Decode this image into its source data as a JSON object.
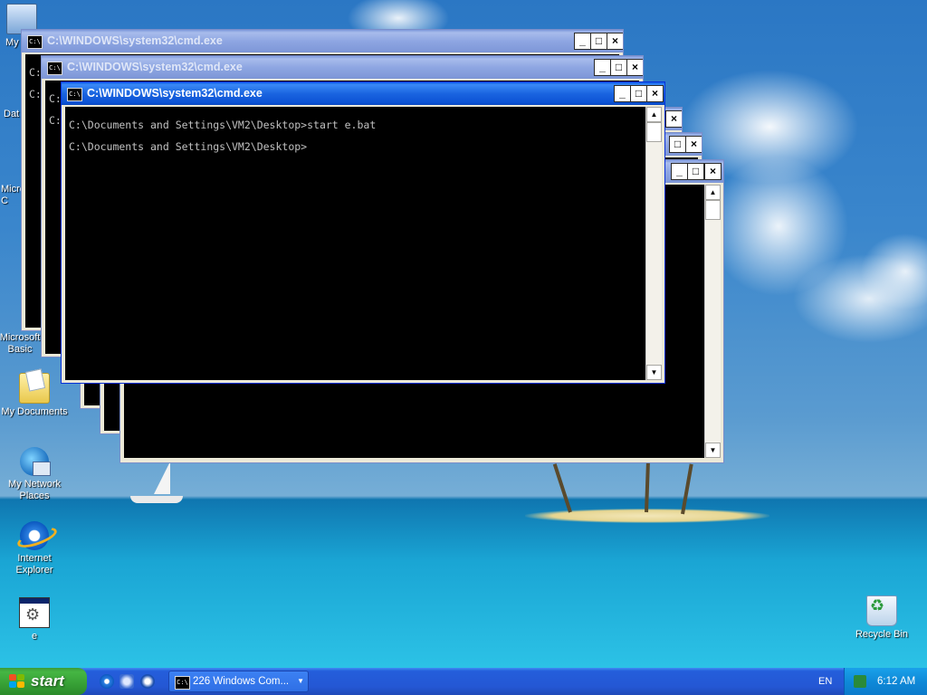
{
  "desktop": {
    "icons": [
      {
        "label": "My",
        "icon": "my-computer-icon"
      },
      {
        "label": "Dat",
        "icon": "data-icon"
      },
      {
        "label": "Micros",
        "icon": "microsoft-icon"
      },
      {
        "label": "C",
        "icon": ""
      },
      {
        "label": "Microsoft Basic",
        "icon": "microsoft-basic-icon"
      },
      {
        "label": "My Documents",
        "icon": "my-documents-icon"
      },
      {
        "label": "My Network Places",
        "icon": "network-places-icon"
      },
      {
        "label": "Internet Explorer",
        "icon": "internet-explorer-icon"
      },
      {
        "label": "e",
        "icon": "batch-file-icon"
      },
      {
        "label": "Recycle Bin",
        "icon": "recycle-bin-icon"
      }
    ]
  },
  "windows": {
    "title": "C:\\WINDOWS\\system32\\cmd.exe",
    "icon_text": "C:\\",
    "buttons": {
      "minimize": "_",
      "maximize": "□",
      "close": "×"
    },
    "scroll_up": "▲",
    "scroll_down": "▼",
    "background_prompt_fragment": "C:",
    "active": {
      "line1": "C:\\Documents and Settings\\VM2\\Desktop>start e.bat",
      "line2": "C:\\Documents and Settings\\VM2\\Desktop>"
    }
  },
  "taskbar": {
    "start_label": "start",
    "task_label": "226 Windows Com...",
    "task_arrow": "▼",
    "language": "EN",
    "clock": "6:12 AM"
  }
}
